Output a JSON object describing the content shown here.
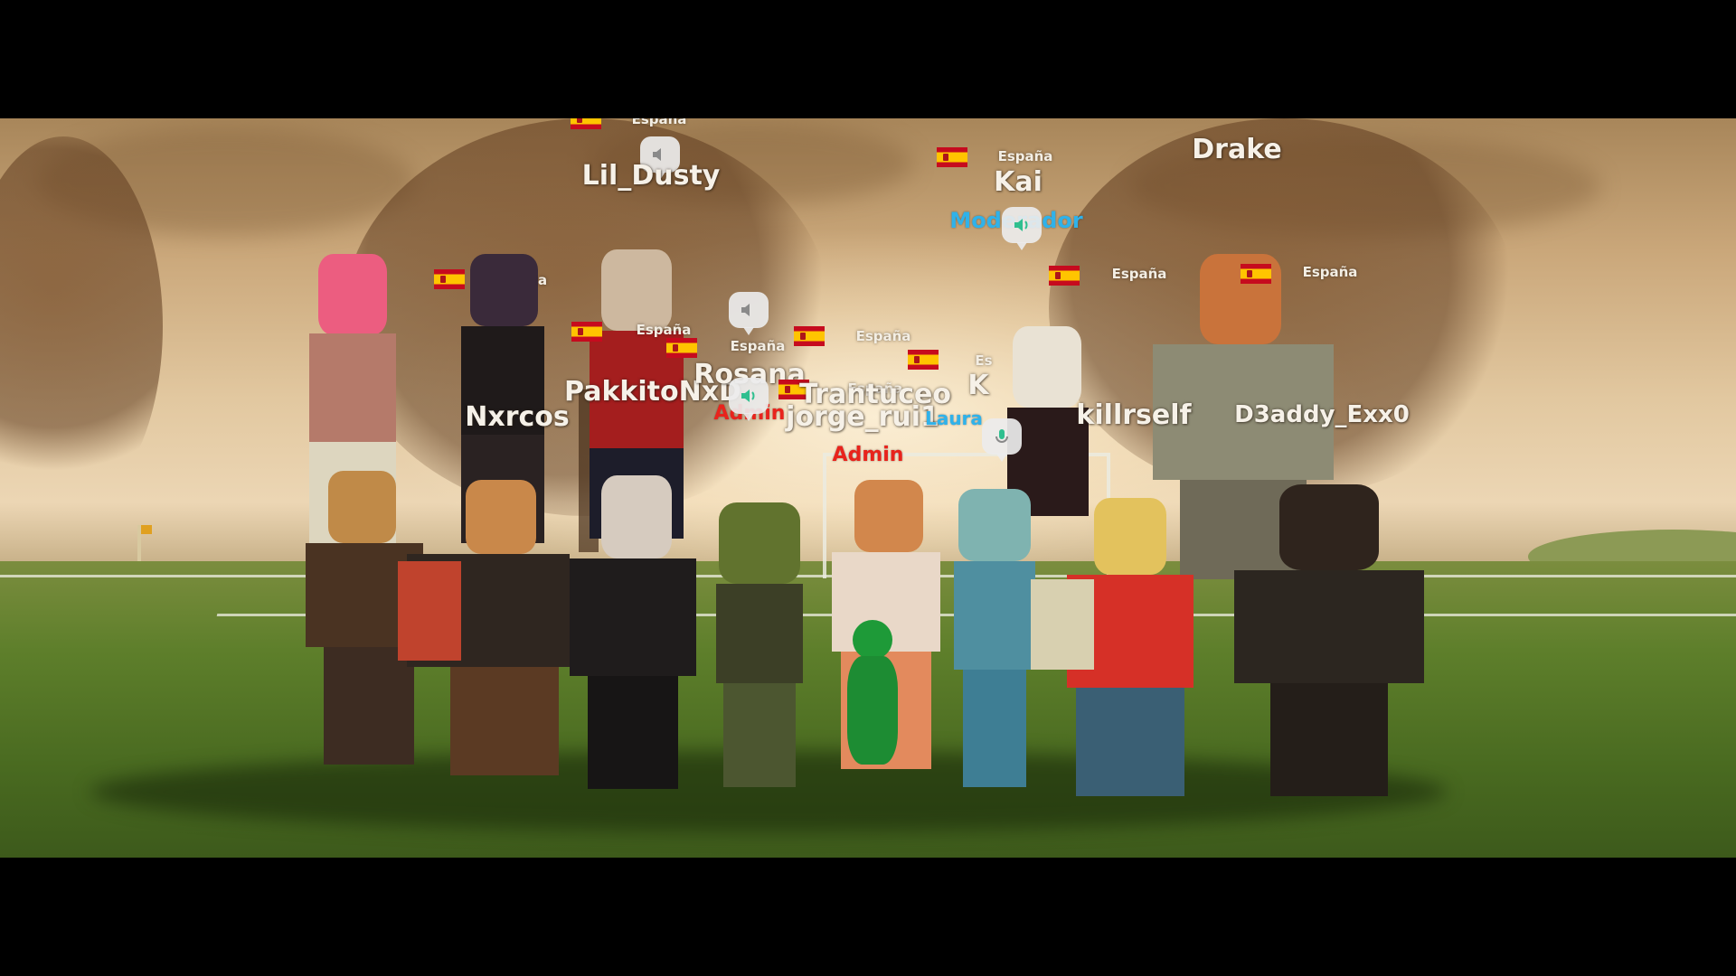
{
  "players": [
    {
      "id": "lil-dusty",
      "name": "Lil_Dusty",
      "region": "España"
    },
    {
      "id": "kai",
      "name": "Kai",
      "region": "España",
      "role": "Moderador"
    },
    {
      "id": "drake",
      "name": "Drake",
      "region": "España"
    },
    {
      "id": "nxrcos",
      "name": "Nxrcos",
      "region": "a"
    },
    {
      "id": "pakkito",
      "name": "PakkitoNxD",
      "region": "España"
    },
    {
      "id": "rosana",
      "name": "Rosana",
      "region": "España",
      "role": "Admin"
    },
    {
      "id": "tranuceo",
      "name": "Trantuceo",
      "region": "España"
    },
    {
      "id": "jorge",
      "name": "jorge_rui1",
      "region": "España",
      "role": "Admin"
    },
    {
      "id": "k-player",
      "name": "K",
      "region": "Es"
    },
    {
      "id": "killrself",
      "name": "killrself",
      "region": "España"
    },
    {
      "id": "d3addy",
      "name": "D3addy_Exx0",
      "region": "España"
    }
  ],
  "partial_tags": {
    "top_region": "España",
    "rosana_region": "España",
    "tranuceo_region": "España",
    "k_role_fragment": "Laura"
  },
  "colors": {
    "nametag": "#f6f1e8",
    "moderator": "#2fb2ea",
    "admin": "#e8231c",
    "voice_bubble": "#ebebeb",
    "voice_active": "#2fbf8f"
  },
  "icons": {
    "voice_inactive": "speaker-icon",
    "voice_active": "speaker-active-icon",
    "voice_mic": "microphone-icon",
    "flag": "spain-flag-icon"
  }
}
